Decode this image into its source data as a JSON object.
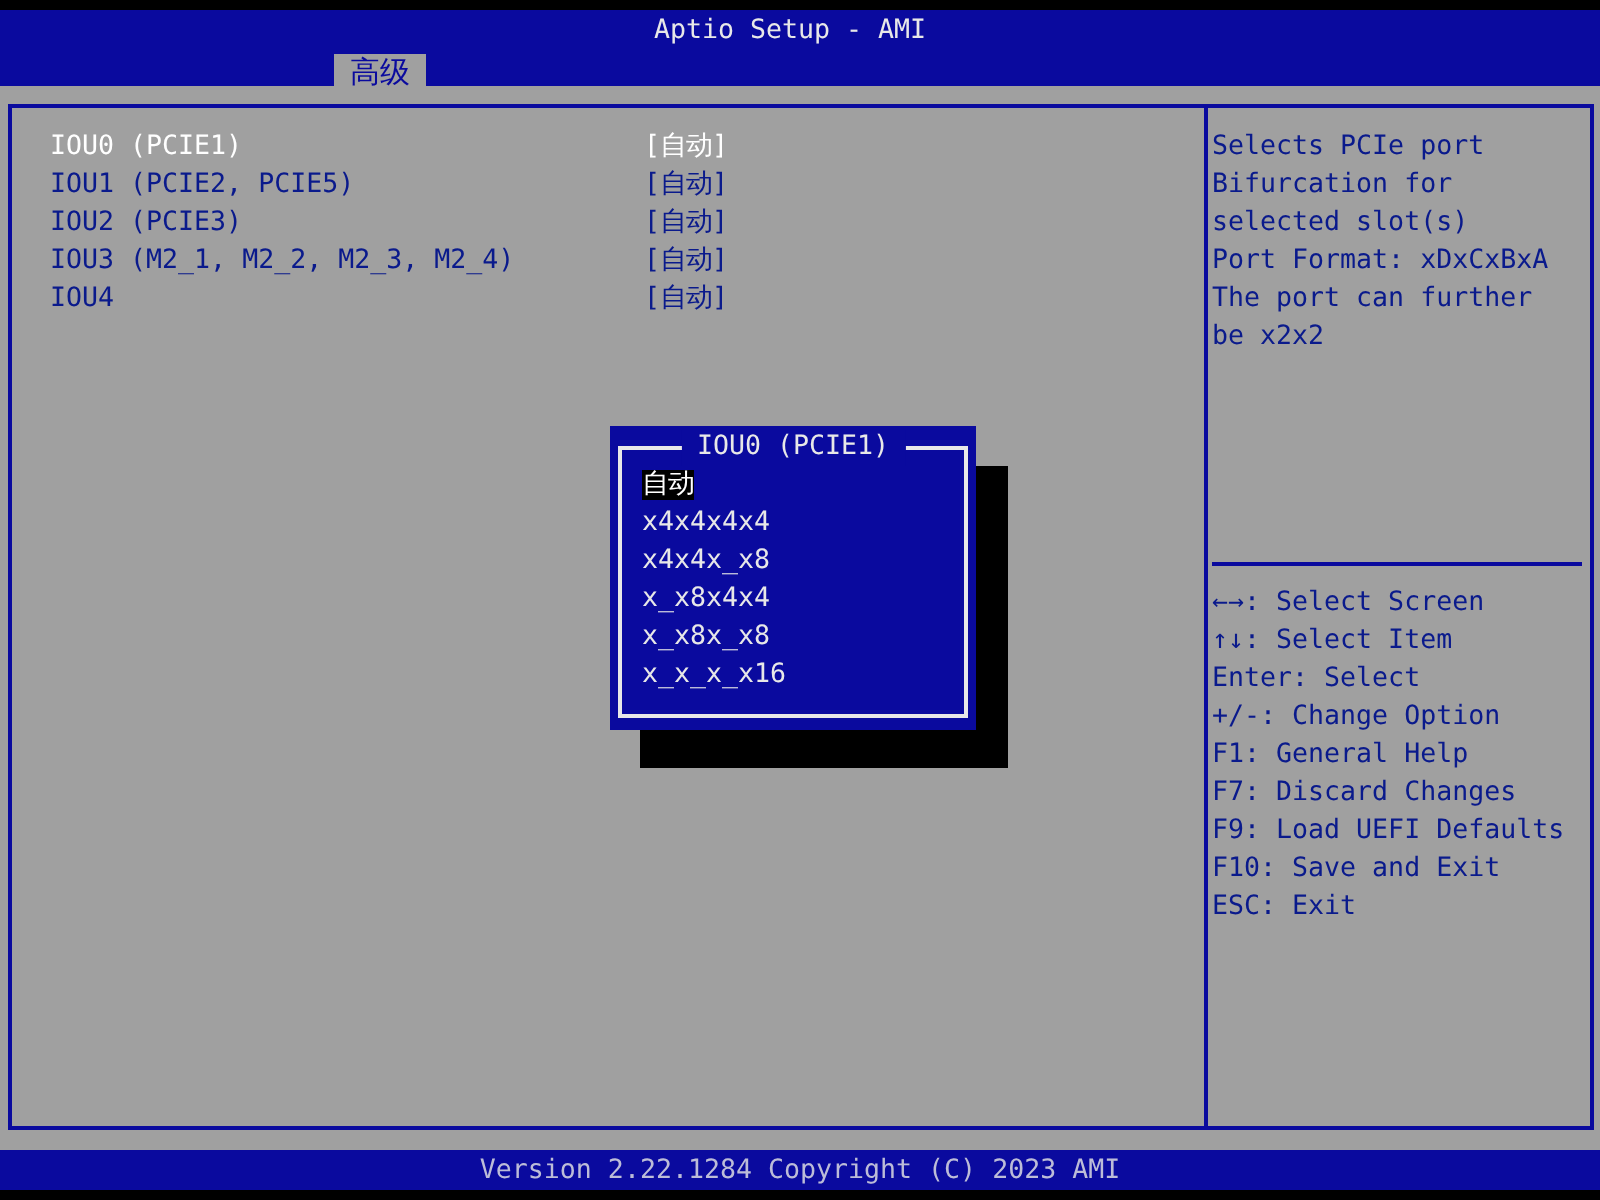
{
  "window": {
    "title": "Aptio Setup - AMI"
  },
  "tabs": [
    {
      "label": "高级",
      "selected": true
    }
  ],
  "settings": [
    {
      "label": "IOU0 (PCIE1)",
      "value": "[自动]",
      "selected": true
    },
    {
      "label": "IOU1 (PCIE2, PCIE5)",
      "value": "[自动]",
      "selected": false
    },
    {
      "label": "IOU2 (PCIE3)",
      "value": "[自动]",
      "selected": false
    },
    {
      "label": "IOU3 (M2_1, M2_2, M2_3, M2_4)",
      "value": "[自动]",
      "selected": false
    },
    {
      "label": "IOU4",
      "value": "[自动]",
      "selected": false
    }
  ],
  "popup": {
    "title": "IOU0 (PCIE1)",
    "options": [
      {
        "label": "自动",
        "selected": true
      },
      {
        "label": "x4x4x4x4",
        "selected": false
      },
      {
        "label": "x4x4x_x8",
        "selected": false
      },
      {
        "label": "x_x8x4x4",
        "selected": false
      },
      {
        "label": "x_x8x_x8",
        "selected": false
      },
      {
        "label": "x_x_x_x16",
        "selected": false
      }
    ]
  },
  "help_lines": [
    "Selects PCIe port",
    "Bifurcation for",
    "selected slot(s)",
    "Port Format: xDxCxBxA",
    "The port can further",
    "be x2x2"
  ],
  "key_help": [
    "←→: Select Screen",
    "↑↓: Select Item",
    "Enter: Select",
    "+/-: Change Option",
    "F1: General Help",
    "F7: Discard Changes",
    "F9: Load UEFI Defaults",
    "F10: Save and Exit",
    "ESC: Exit"
  ],
  "status_bar": "Version 2.22.1284 Copyright (C) 2023 AMI"
}
